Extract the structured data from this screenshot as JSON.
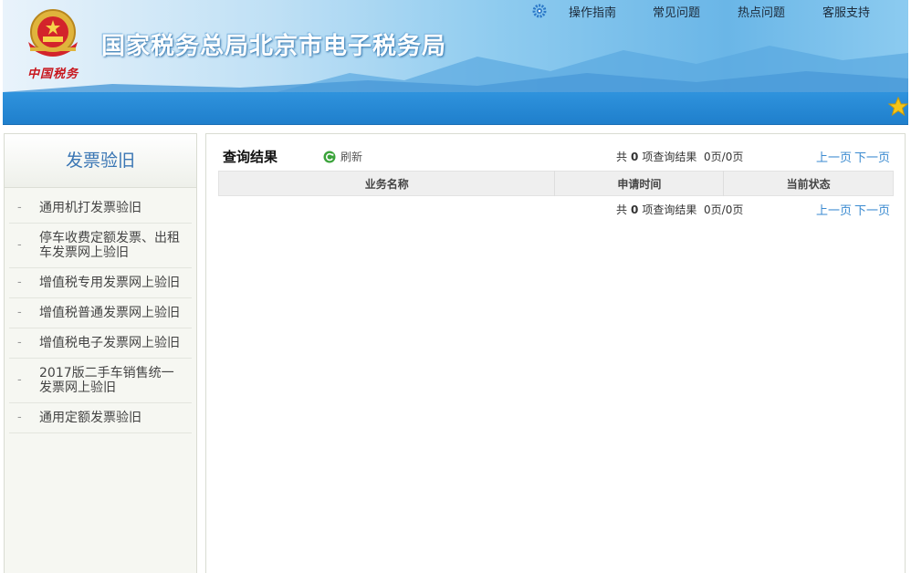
{
  "header": {
    "site_title": "国家税务总局北京市电子税务局",
    "emblem_caption": "中国税务",
    "nav": [
      {
        "label": "操作指南"
      },
      {
        "label": "常见问题"
      },
      {
        "label": "热点问题"
      },
      {
        "label": "客服支持"
      }
    ],
    "colors": {
      "accent_bar": "#1f7fcc",
      "title_text": "#ffffff"
    }
  },
  "sidebar": {
    "title": "发票验旧",
    "items": [
      {
        "label": "通用机打发票验旧"
      },
      {
        "label": "停车收费定额发票、出租车发票网上验旧"
      },
      {
        "label": "增值税专用发票网上验旧"
      },
      {
        "label": "增值税普通发票网上验旧"
      },
      {
        "label": "增值税电子发票网上验旧"
      },
      {
        "label": "2017版二手车销售统一发票网上验旧"
      },
      {
        "label": "通用定额发票验旧"
      }
    ]
  },
  "main": {
    "title": "查询结果",
    "refresh_label": "刷新",
    "pager": {
      "prefix": "共",
      "count": "0",
      "suffix": "项查询结果",
      "pages": "0页/0页",
      "prev": "上一页",
      "next": "下一页"
    },
    "table": {
      "columns": [
        "业务名称",
        "申请时间",
        "当前状态"
      ],
      "rows": []
    }
  },
  "icons": {
    "gear": "gear-icon",
    "star": "star-icon",
    "refresh": "refresh-icon",
    "emblem": "national-emblem-icon"
  }
}
